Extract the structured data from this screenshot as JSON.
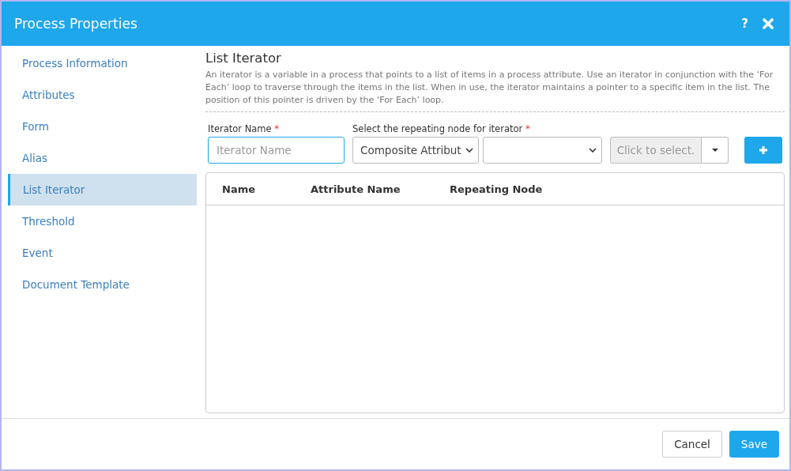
{
  "window": {
    "title": "Process Properties",
    "help": "?"
  },
  "sidebar": {
    "items": [
      {
        "label": "Process Information",
        "selected": false
      },
      {
        "label": "Attributes",
        "selected": false
      },
      {
        "label": "Form",
        "selected": false
      },
      {
        "label": "Alias",
        "selected": false
      },
      {
        "label": "List Iterator",
        "selected": true
      },
      {
        "label": "Threshold",
        "selected": false
      },
      {
        "label": "Event",
        "selected": false
      },
      {
        "label": "Document Template",
        "selected": false
      }
    ]
  },
  "section": {
    "title": "List Iterator",
    "description": "An iterator is a variable in a process that points to a list of items in a process attribute. Use an iterator in conjunction with the ‘For Each’ loop to traverse through the items in the list. When in use, the iterator maintains a pointer to a specific item in the list. The position of this pointer is driven by the ‘For Each’ loop."
  },
  "form": {
    "name_label": "Iterator Name",
    "name_required": "*",
    "name_placeholder": "Iterator Name",
    "node_label": "Select the repeating node for iterator",
    "node_required": "*",
    "node_type": "Composite Attribut",
    "node_picker_placeholder": "Click to select."
  },
  "table": {
    "columns": [
      "Name",
      "Attribute Name",
      "Repeating Node"
    ]
  },
  "buttons": [
    "Cancel",
    "Save"
  ]
}
